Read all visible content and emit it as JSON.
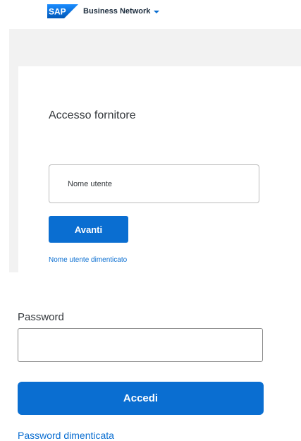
{
  "header": {
    "logo_text": "SAP",
    "product_name": "Business Network"
  },
  "login_card": {
    "title": "Accesso fornitore",
    "username_placeholder": "Nome utente",
    "next_label": "Avanti",
    "forgot_username_label": "Nome utente dimenticato"
  },
  "password_section": {
    "label": "Password",
    "value": "",
    "login_label": "Accedi",
    "forgot_password_label": "Password dimenticata"
  },
  "colors": {
    "brand_blue": "#0a6ed1",
    "background_gray": "#f2f2f2"
  }
}
